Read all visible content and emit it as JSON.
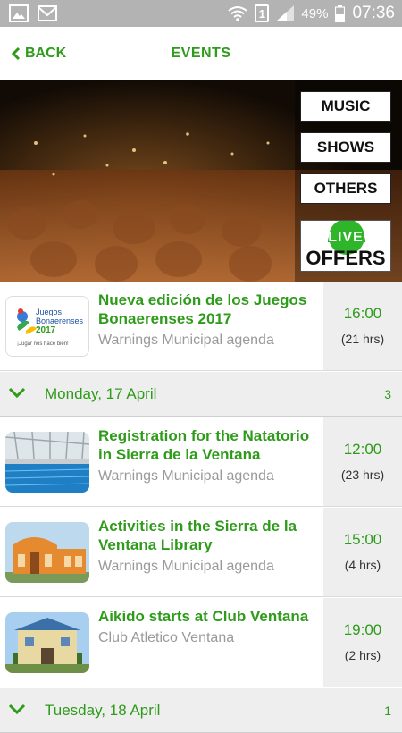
{
  "status_bar": {
    "sim": "1",
    "battery": "49%",
    "time": "07:36"
  },
  "header": {
    "back_label": "BACK",
    "title": "EVENTS"
  },
  "hero": {
    "categories": [
      "MUSIC",
      "SHOWS",
      "OTHERS"
    ],
    "live_top": "LIVE",
    "live_bottom": "OFFERS"
  },
  "events_top": [
    {
      "title": "Nueva edición de los Juegos Bonaerenses 2017",
      "subtitle": "Warnings Municipal agenda",
      "time": "16:00",
      "duration": "(21 hrs)",
      "thumb_text": {
        "line1": "Juegos",
        "line2": "Bonaerenses",
        "year": "2017",
        "slogan": "¡Jugar nos hace bien!"
      }
    }
  ],
  "days": [
    {
      "label": "Monday, 17 April",
      "count": "3",
      "events": [
        {
          "title": "Registration for the Natatorio in Sierra de la Ventana",
          "subtitle": "Warnings Municipal agenda",
          "time": "12:00",
          "duration": "(23 hrs)"
        },
        {
          "title": "Activities in the Sierra de la Ventana Library",
          "subtitle": "Warnings Municipal agenda",
          "time": "15:00",
          "duration": "(4 hrs)"
        },
        {
          "title": "Aikido starts at Club Ventana",
          "subtitle": "Club Atletico Ventana",
          "time": "19:00",
          "duration": "(2 hrs)"
        }
      ]
    },
    {
      "label": "Tuesday, 18 April",
      "count": "1",
      "events": []
    }
  ],
  "colors": {
    "accent": "#2e9b1a",
    "status_bar": "#b3b3b3",
    "time_column": "#eeeeee",
    "subtitle": "#9a9a9a"
  }
}
